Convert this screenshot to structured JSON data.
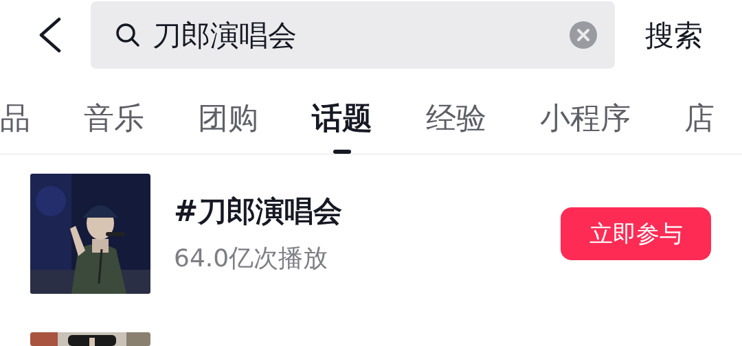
{
  "search": {
    "query": "刀郎演唱会",
    "action": "搜索"
  },
  "tabs": [
    {
      "label": "品",
      "selected": false
    },
    {
      "label": "音乐",
      "selected": false
    },
    {
      "label": "团购",
      "selected": false
    },
    {
      "label": "话题",
      "selected": true
    },
    {
      "label": "经验",
      "selected": false
    },
    {
      "label": "小程序",
      "selected": false
    },
    {
      "label": "店",
      "selected": false
    }
  ],
  "results": [
    {
      "kind": "picture",
      "title": "#刀郎演唱会",
      "subtitle": "64.0亿次播放",
      "button": "立即参与"
    },
    {
      "kind": "picture"
    }
  ]
}
